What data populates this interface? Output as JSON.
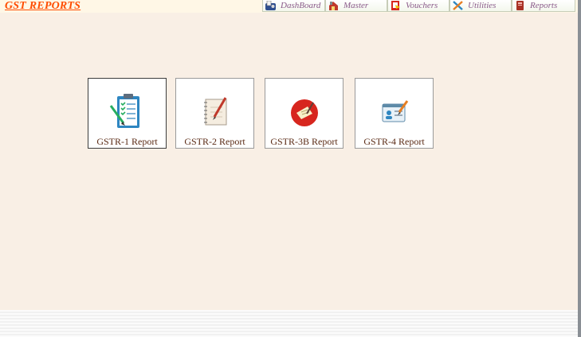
{
  "app": {
    "title": "GST REPORTS",
    "accent_color": "#ff4d00",
    "background_color": "#f9efe5"
  },
  "nav": {
    "items": [
      {
        "label": "DashBoard",
        "icon": "dashboard-icon"
      },
      {
        "label": "Master",
        "icon": "master-icon"
      },
      {
        "label": "Vouchers",
        "icon": "vouchers-icon"
      },
      {
        "label": "Utilities",
        "icon": "utilities-icon"
      },
      {
        "label": "Reports",
        "icon": "reports-icon"
      }
    ]
  },
  "reports": {
    "cards": [
      {
        "label": "GSTR-1 Report",
        "icon": "clipboard-checklist-icon",
        "selected": true
      },
      {
        "label": "GSTR-2 Report",
        "icon": "notebook-pen-icon",
        "selected": false
      },
      {
        "label": "GSTR-3B Report",
        "icon": "red-circle-note-icon",
        "selected": false
      },
      {
        "label": "GSTR-4 Report",
        "icon": "id-card-pen-icon",
        "selected": false
      }
    ]
  }
}
